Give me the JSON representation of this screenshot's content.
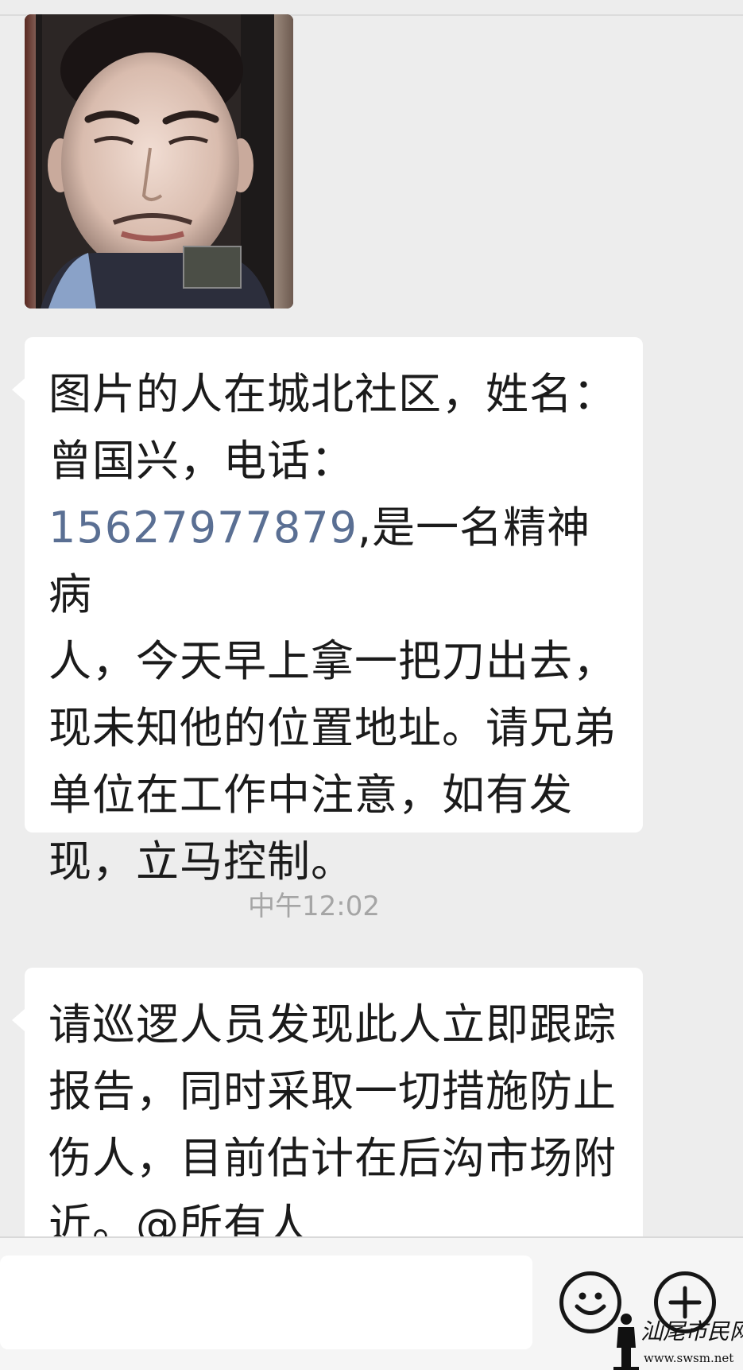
{
  "messages": [
    {
      "type": "image",
      "alt": ""
    },
    {
      "type": "text",
      "lines": [
        "图片的人在城北社区，姓名：",
        "曾国兴，电话：",
        "",
        "人，今天早上拿一把刀出去，",
        "现未知他的位置地址。请兄弟",
        "单位在工作中注意，如有发",
        "现，立马控制。"
      ],
      "phone": "15627977879",
      "phone_suffix": ",是一名精神病"
    },
    {
      "type": "text",
      "lines": [
        "请巡逻人员发现此人立即跟踪",
        "报告，同时采取一切措施防止",
        "伤人，目前估计在后沟市场附",
        "近。@所有人"
      ]
    }
  ],
  "timestamp": "中午12:02",
  "input": {
    "placeholder": "",
    "value": ""
  },
  "icons": {
    "emoji": "emoji-icon",
    "plus": "plus-icon"
  },
  "watermark": {
    "title": "汕尾市民网",
    "site": "www.swsm.net"
  },
  "colors": {
    "background": "#ededed",
    "bubble": "#ffffff",
    "link": "#5a6f93",
    "timestamp": "#a5a5a5"
  }
}
